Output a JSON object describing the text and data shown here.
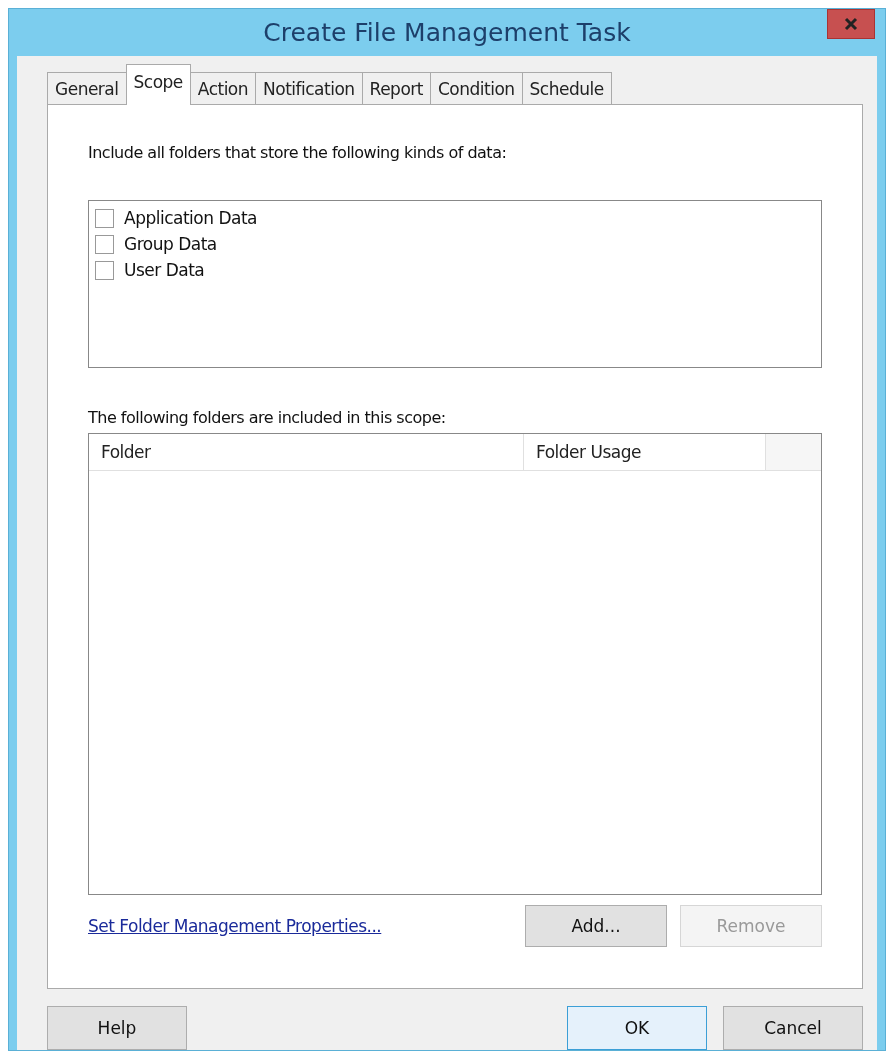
{
  "window": {
    "title": "Create File Management Task"
  },
  "tabs": [
    {
      "label": "General",
      "selected": false
    },
    {
      "label": "Scope",
      "selected": true
    },
    {
      "label": "Action",
      "selected": false
    },
    {
      "label": "Notification",
      "selected": false
    },
    {
      "label": "Report",
      "selected": false
    },
    {
      "label": "Condition",
      "selected": false
    },
    {
      "label": "Schedule",
      "selected": false
    }
  ],
  "scope": {
    "data_kinds_label": "Include all folders that store the following kinds of data:",
    "data_kinds": [
      {
        "label": "Application Data",
        "checked": false
      },
      {
        "label": "Group Data",
        "checked": false
      },
      {
        "label": "User Data",
        "checked": false
      }
    ],
    "folders_label": "The following folders are included in this scope:",
    "folders_table": {
      "columns": [
        "Folder",
        "Folder Usage"
      ]
    },
    "link": "Set Folder Management Properties...",
    "buttons": [
      {
        "label": "Add...",
        "disabled": false
      },
      {
        "label": "Remove",
        "disabled": true
      }
    ]
  },
  "footer_buttons": [
    {
      "label": "Help",
      "default": false
    },
    {
      "label": "OK",
      "default": true
    },
    {
      "label": "Cancel",
      "default": false
    }
  ]
}
